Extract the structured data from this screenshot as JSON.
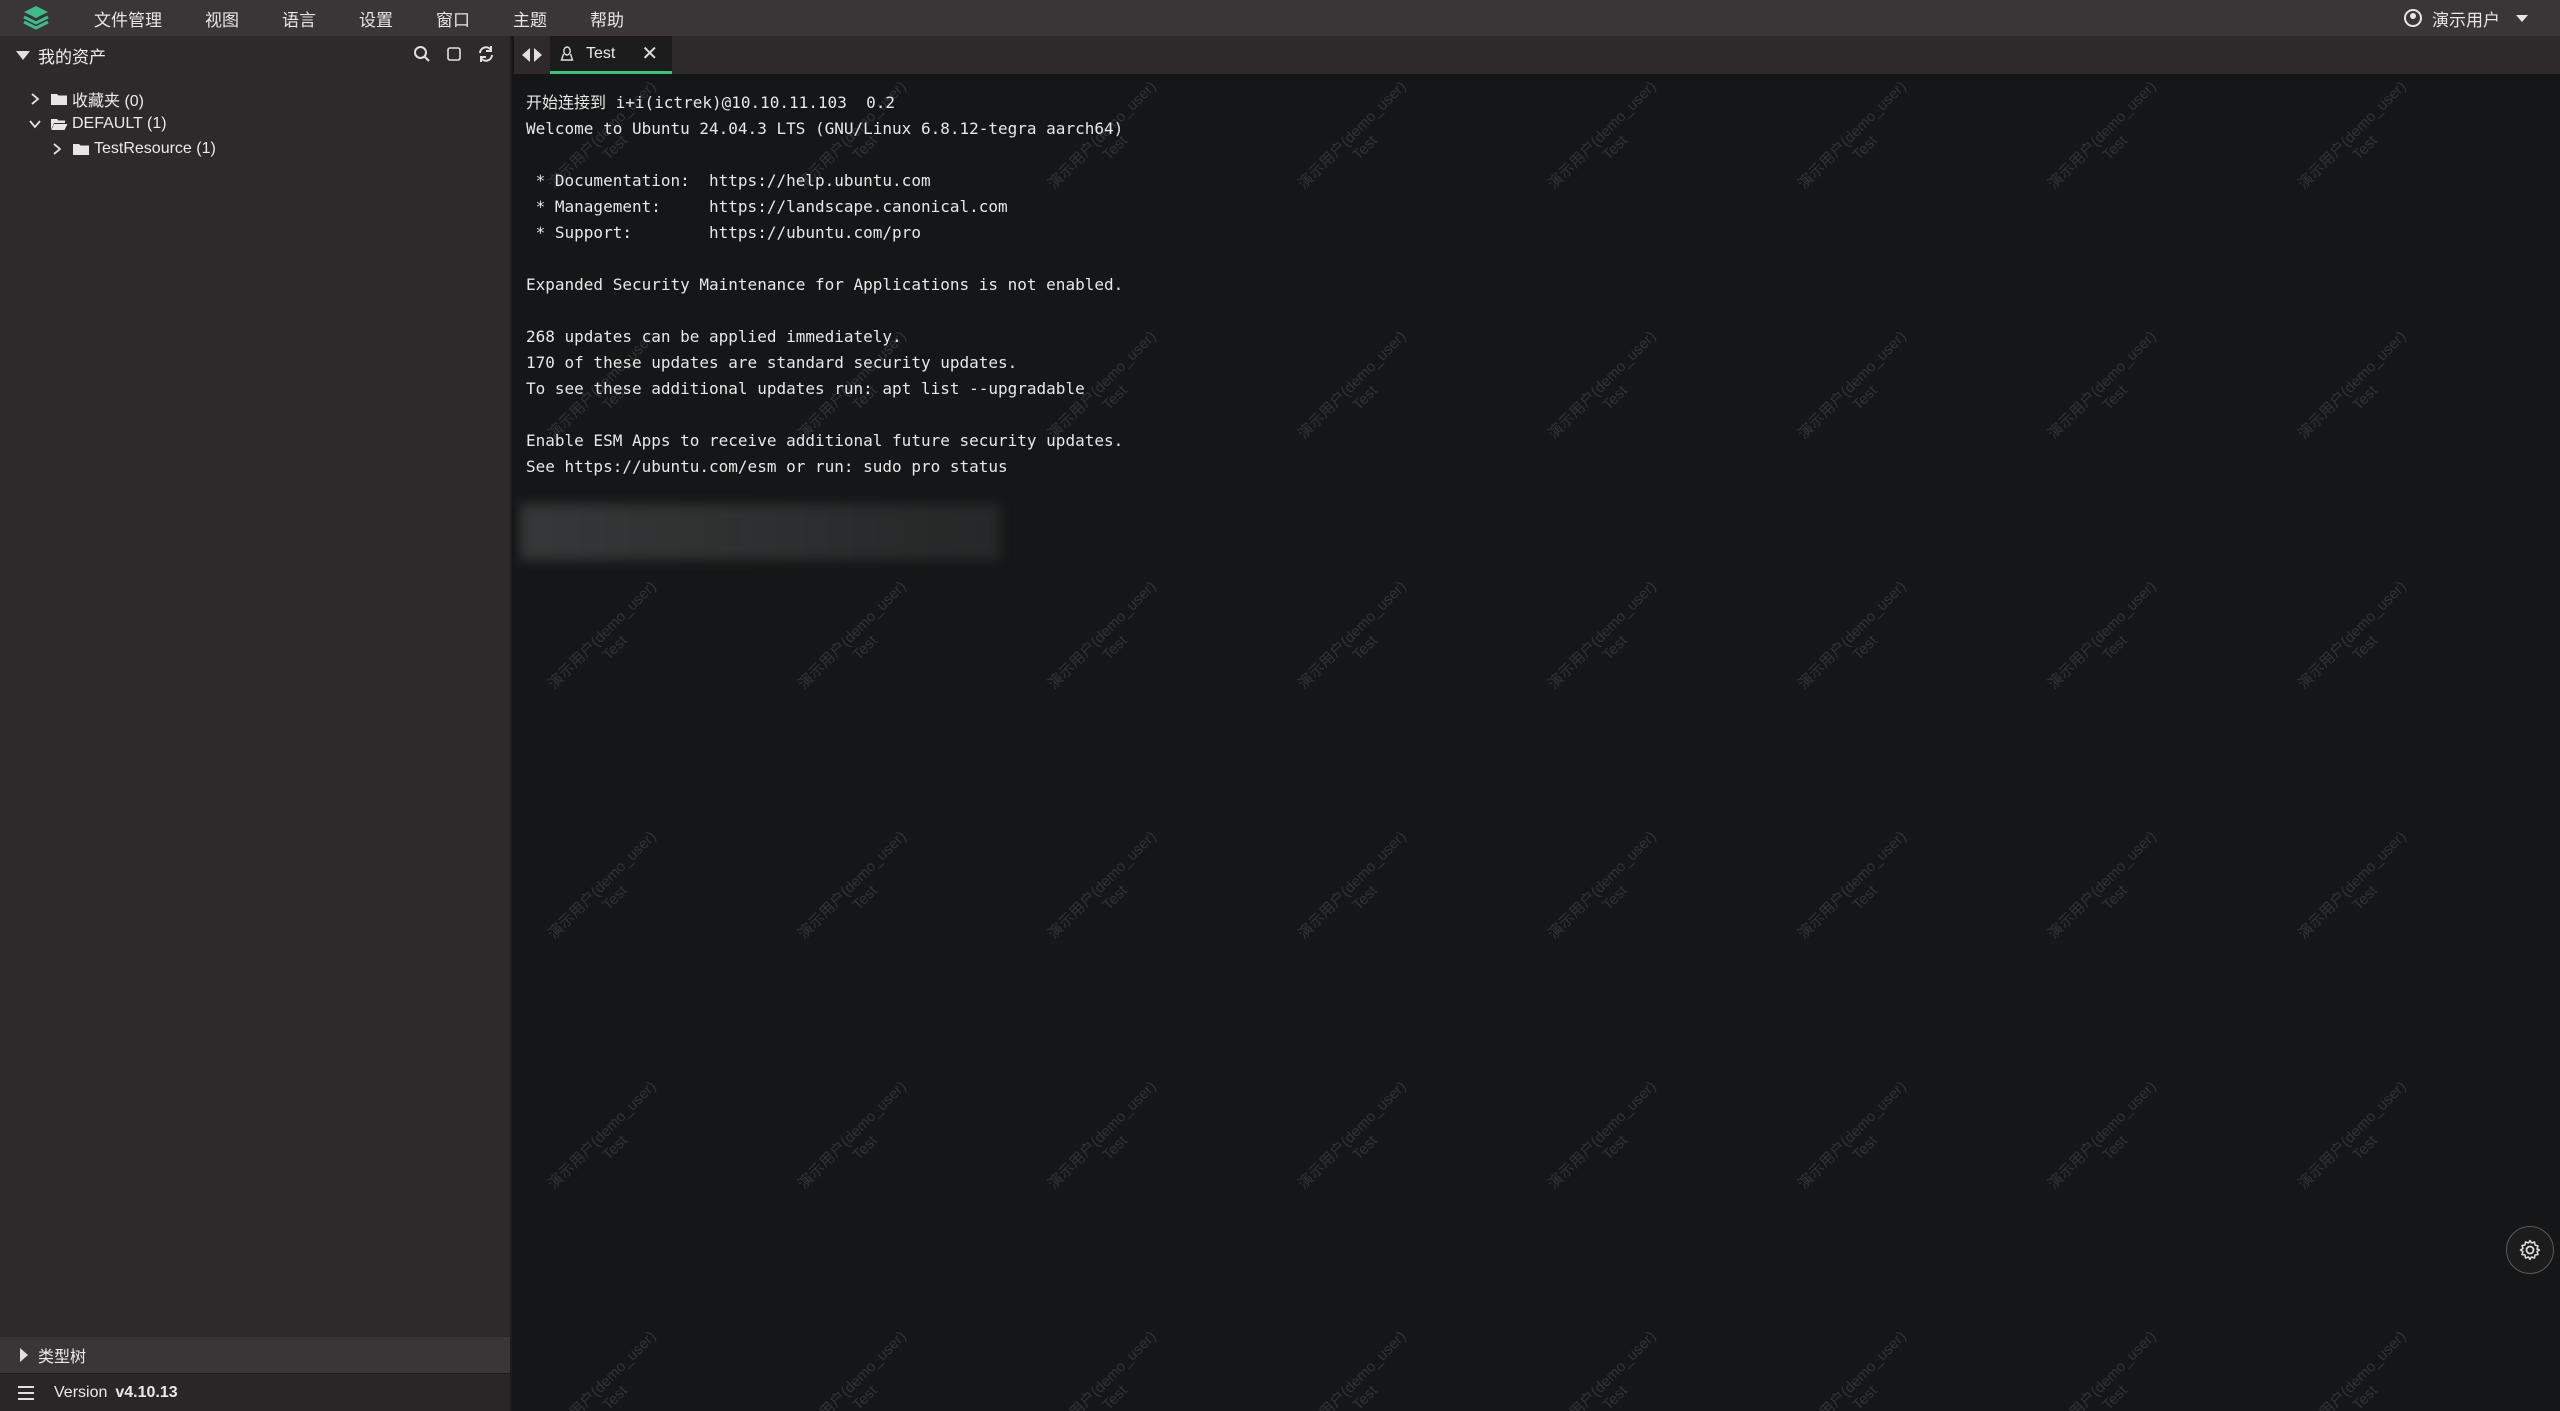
{
  "menubar": {
    "items": [
      "文件管理",
      "视图",
      "语言",
      "设置",
      "窗口",
      "主题",
      "帮助"
    ],
    "user": "演示用户"
  },
  "sidebar": {
    "title": "我的资产",
    "tree": [
      {
        "label": "收藏夹 (0)",
        "expanded": false
      },
      {
        "label": "DEFAULT (1)",
        "expanded": true
      },
      {
        "label": "TestResource (1)",
        "expanded": false
      }
    ],
    "bottom_section": "类型树",
    "version_label": "Version",
    "version_number": "v4.10.13"
  },
  "tabs": [
    {
      "label": "Test",
      "icon": "linux-icon",
      "active": true
    }
  ],
  "terminal": {
    "lines": [
      "开始连接到 i+i(ictrek)@10.10.11.103  0.2",
      "Welcome to Ubuntu 24.04.3 LTS (GNU/Linux 6.8.12-tegra aarch64)",
      "",
      " * Documentation:  https://help.ubuntu.com",
      " * Management:     https://landscape.canonical.com",
      " * Support:        https://ubuntu.com/pro",
      "",
      "Expanded Security Maintenance for Applications is not enabled.",
      "",
      "268 updates can be applied immediately.",
      "170 of these updates are standard security updates.",
      "To see these additional updates run: apt list --upgradable",
      "",
      "Enable ESM Apps to receive additional future security updates.",
      "See https://ubuntu.com/esm or run: sudo pro status"
    ],
    "watermark_line1": "演示用户(demo_user)",
    "watermark_line2": "Test"
  },
  "colors": {
    "accent": "#35c57d",
    "menubar_bg": "#3a3536",
    "sidebar_bg": "#2e2a2b",
    "terminal_bg": "#141617"
  }
}
